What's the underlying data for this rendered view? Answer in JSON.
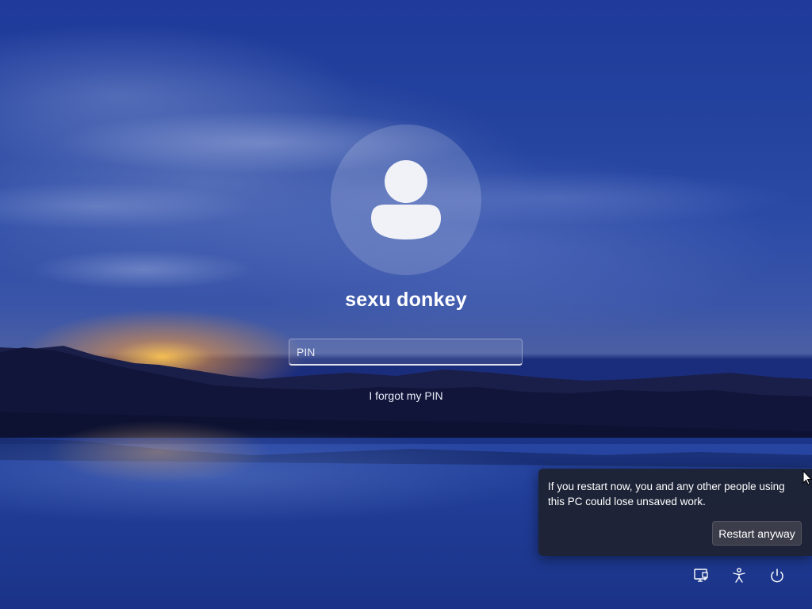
{
  "login": {
    "username": "sexu donkey",
    "pin_placeholder": "PIN",
    "pin_value": "",
    "forgot_pin_label": "I forgot my PIN"
  },
  "restart_flyout": {
    "message": "If you restart now, you and any other people using this PC could lose unsaved work.",
    "button_label": "Restart anyway"
  },
  "corner_icons": [
    {
      "name": "network-icon",
      "label": "Network"
    },
    {
      "name": "accessibility-icon",
      "label": "Accessibility"
    },
    {
      "name": "power-icon",
      "label": "Power"
    }
  ],
  "colors": {
    "flyout_background": "#1e2230",
    "button_background": "#3b3e4a",
    "text": "#ffffff"
  }
}
